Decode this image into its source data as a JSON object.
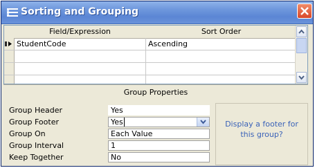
{
  "window": {
    "title": "Sorting and Grouping"
  },
  "grid": {
    "columns": [
      "Field/Expression",
      "Sort Order"
    ],
    "rows": [
      {
        "field": "StudentCode",
        "sort": "Ascending"
      },
      {
        "field": "",
        "sort": ""
      },
      {
        "field": "",
        "sort": ""
      },
      {
        "field": "",
        "sort": ""
      }
    ]
  },
  "group_properties": {
    "heading": "Group Properties",
    "props": [
      {
        "name": "Group Header",
        "value": "Yes"
      },
      {
        "name": "Group Footer",
        "value": "Yes"
      },
      {
        "name": "Group On",
        "value": "Each Value"
      },
      {
        "name": "Group Interval",
        "value": "1"
      },
      {
        "name": "Keep Together",
        "value": "No"
      }
    ],
    "help_text": "Display a footer for this group?"
  },
  "colors": {
    "title_bar": "#6f98dd",
    "close_button": "#d9472a",
    "help_text": "#3a62b8"
  }
}
